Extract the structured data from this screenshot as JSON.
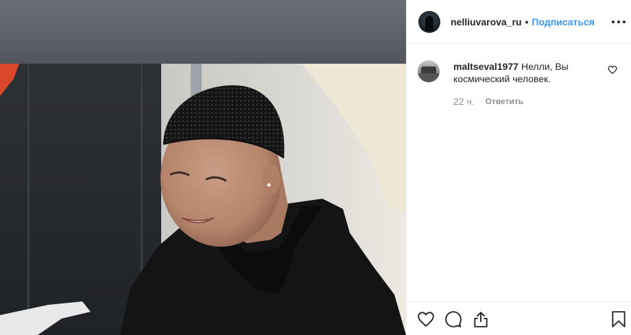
{
  "post": {
    "owner_username": "nelliuvarova_ru",
    "separator": "•",
    "follow_label": "Подписаться"
  },
  "comments": [
    {
      "username": "maltseval1977",
      "text": "Нелли, Вы космический человек.",
      "time": "22 ч.",
      "reply_label": "Ответить"
    }
  ],
  "icons": {
    "more": "more-options-icon",
    "comment_like": "heart-outline-icon",
    "like": "heart-outline-icon",
    "comment": "comment-bubble-icon",
    "share": "share-icon",
    "save": "bookmark-icon"
  },
  "colors": {
    "link_blue": "#3897f0",
    "text": "#262626",
    "muted": "#8e8e8e",
    "divider": "#efefef"
  }
}
